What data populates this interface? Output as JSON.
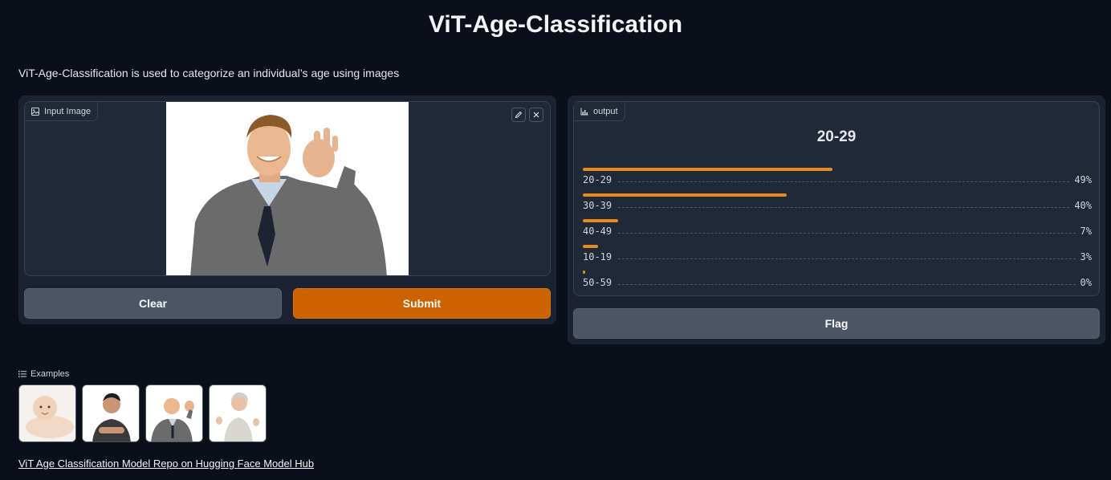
{
  "header": {
    "title": "ViT-Age-Classification",
    "description": "ViT-Age-Classification is used to categorize an individual’s age using images"
  },
  "input": {
    "label": "Input Image",
    "icon": "image-icon",
    "edit_icon": "pencil-icon",
    "close_icon": "close-icon"
  },
  "buttons": {
    "clear": "Clear",
    "submit": "Submit",
    "flag": "Flag"
  },
  "output": {
    "label": "output",
    "icon": "bar-chart-icon",
    "top_label": "20-29",
    "confidences": [
      {
        "label": "20-29",
        "value": 0.49,
        "display": "49%"
      },
      {
        "label": "30-39",
        "value": 0.4,
        "display": "40%"
      },
      {
        "label": "40-49",
        "value": 0.07,
        "display": "7%"
      },
      {
        "label": "10-19",
        "value": 0.03,
        "display": "3%"
      },
      {
        "label": "50-59",
        "value": 0.0,
        "display": "0%"
      }
    ]
  },
  "examples": {
    "label": "Examples",
    "icon": "list-icon",
    "items": [
      "baby",
      "young-man",
      "businessman",
      "elderly-woman"
    ]
  },
  "footer": {
    "link_text": "ViT Age Classification Model Repo on Hugging Face Model Hub"
  },
  "colors": {
    "background": "#0b0f19",
    "accent": "#cc6300",
    "bar": "#ea8a1e"
  }
}
